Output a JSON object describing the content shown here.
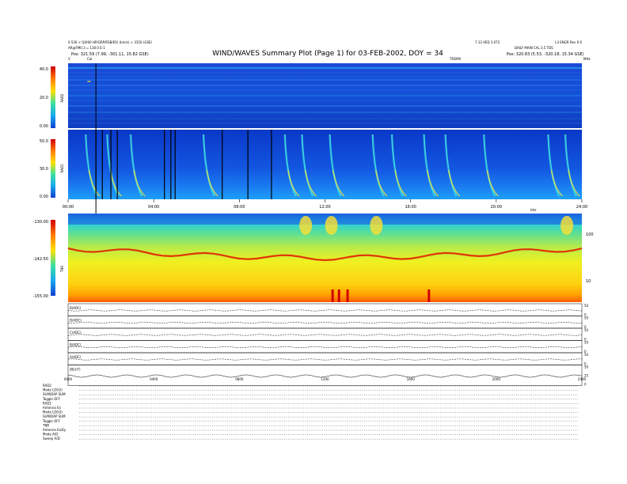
{
  "header": {
    "title": "WIND/WAVES Summary Plot (Page 1) for 03-FEB-2002, DOY = 34",
    "left_line1": "0.530 < Q(000 HP/GRP/RSB/E0) (km/s) < 3150 (GSE)",
    "left_line2": "AR@FM0.3 = 130.0 E-1",
    "pos_left": "Pos:   321.59 (7.99, -301.11, 15.82 GSE)",
    "right_line1": "7.13 VED 3.072",
    "right_line2": "L3 ENGR Rev 0.0",
    "right_line3": "DAILY  MAIN CAL 3.5 TDS",
    "pos_right": "Pos:   320.83 (5.53, -320.18, 15.34 GSE)",
    "tds_label": "TDSMX",
    "cal_label": "Cal",
    "spike_label": "V"
  },
  "rad2": {
    "label": "RAD2",
    "units_label": "MHz",
    "yticks": [
      "40.0",
      "20.0",
      "0.00"
    ],
    "colors": {
      "bg": "#1552d8",
      "deep": "#0a2fa8"
    }
  },
  "rad1": {
    "label": "RAD1",
    "yticks": [
      "50.0",
      "30.0",
      "0.00"
    ],
    "xticks": [
      "00:00",
      "04:00",
      "08:00",
      "12:00",
      "16:00",
      "20:00",
      "24:00"
    ]
  },
  "tnr": {
    "label": "TNR",
    "yticks": [
      "-130.00",
      "-142.50",
      "-155.00"
    ],
    "right_ticks": [
      "100",
      "10"
    ],
    "freq_label": "kHz"
  },
  "lineplots": {
    "rows": [
      {
        "label": "B(ADC)",
        "right": [
          "50",
          "0"
        ]
      },
      {
        "label": "D(ADC)",
        "right": [
          "50",
          "0"
        ]
      },
      {
        "label": "C(ADC)",
        "right": [
          "50",
          "0"
        ]
      },
      {
        "label": "B(ADC)",
        "right": [
          "50",
          "0"
        ]
      },
      {
        "label": "A(ADC)",
        "right": [
          "50",
          "0"
        ]
      },
      {
        "label": "|B|(nT)",
        "right": [
          "50",
          "25",
          "0"
        ]
      }
    ],
    "xticks": [
      "0000",
      "0400",
      "0800",
      "1200",
      "1600",
      "2000",
      "2400"
    ]
  },
  "footer": {
    "lines": [
      "RAD2",
      "Mode   LOG(I)",
      "SUM/DAP  SUM",
      "Toggle   OFF",
      "RAD1",
      "Antenna      Ex",
      "Mode   LOG(I)",
      "SUM/DAP  SUM",
      "Toggle   OFF",
      "TNR",
      "Antenna  Ex/Ey",
      "Mode    A/D",
      "Sweep    A/D"
    ]
  },
  "chart_data": {
    "type": "heatmap",
    "title": "WIND/WAVES Summary Plot (Page 1) for 03-FEB-2002, DOY = 34",
    "x_range_hours": [
      0,
      24
    ],
    "panels": [
      {
        "name": "RAD2",
        "color_scale_range": [
          0.0,
          40.0
        ]
      },
      {
        "name": "RAD1",
        "color_scale_range": [
          0.0,
          50.0
        ]
      },
      {
        "name": "TNR",
        "color_scale_range": [
          -155.0,
          -130.0
        ]
      }
    ],
    "radio_burst_times_hours": [
      0.9,
      1.9,
      3.0,
      6.4,
      10.2,
      11.0,
      12.3,
      14.3,
      15.2,
      16.7,
      17.7,
      19.5,
      22.5,
      23.3
    ],
    "data_gap_lines_hours": [
      1.3,
      1.6,
      2.0,
      2.3,
      4.5,
      4.8,
      5.0,
      7.2,
      8.4,
      9.5
    ]
  }
}
